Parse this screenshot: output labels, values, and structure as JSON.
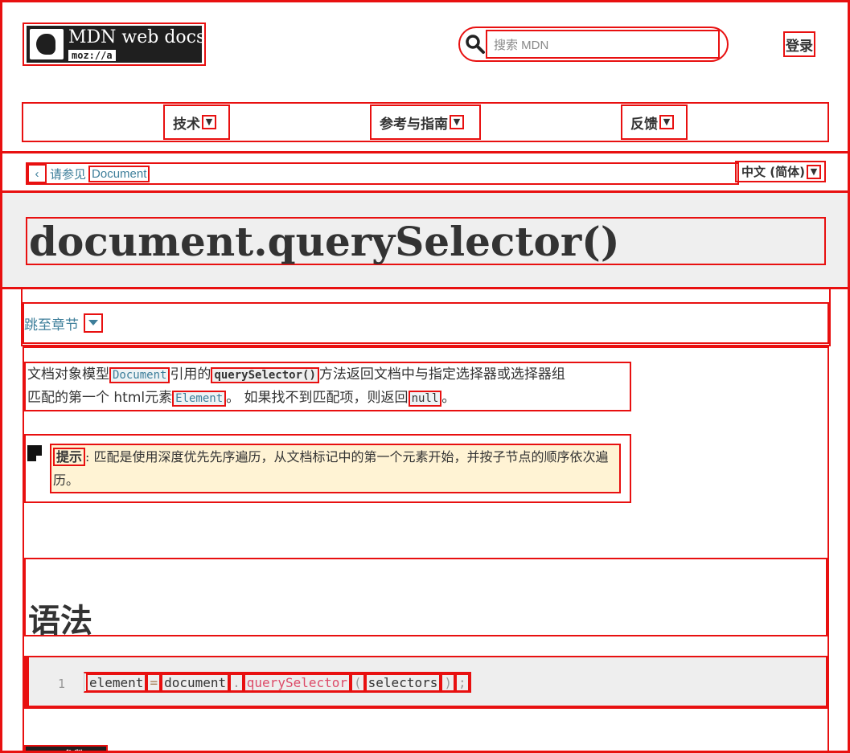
{
  "header": {
    "logo_text": "MDN web docs",
    "logo_sub": "moz://a",
    "search_placeholder": "搜索 MDN",
    "login": "登录"
  },
  "nav": {
    "items": [
      {
        "label": "技术"
      },
      {
        "label": "参考与指南"
      },
      {
        "label": "反馈"
      }
    ]
  },
  "breadcrumb": {
    "see_also": "请参见",
    "link": "Document",
    "language": "中文 (简体)"
  },
  "page": {
    "title": "document.querySelector()",
    "jump_label": "跳至章节"
  },
  "intro": {
    "t1": "文档对象模型",
    "c1": "Document",
    "t2": "引用的",
    "c2": "querySelector()",
    "t3": "方法返回文档中与指定选择器或选择器组",
    "t4": "匹配的第一个 html元素",
    "c3": "Element",
    "t5": "。 如果找不到匹配项，则返回",
    "c4": "null",
    "t6": "。"
  },
  "note": {
    "label": "提示",
    "text": ": 匹配是使用深度优先先序遍历，从文档标记中的第一个元素开始，并按子节点的顺序依次遍历。"
  },
  "syntax": {
    "heading": "语法",
    "line_number": "1",
    "tokens": [
      "element",
      "=",
      "document",
      ".",
      "querySelector",
      "(",
      "selectors",
      ")",
      ";"
    ]
  },
  "params": {
    "heading": "参数"
  },
  "colors": {
    "link": "#3d7e9a",
    "outline": "#e81010",
    "note_bg": "#fff3d4",
    "title_band": "#efefef"
  },
  "icons": {
    "search": "search-icon",
    "logo": "mdn-lion-logo",
    "caret": "caret-down-icon",
    "back": "chevron-left-icon",
    "note": "note-icon"
  }
}
